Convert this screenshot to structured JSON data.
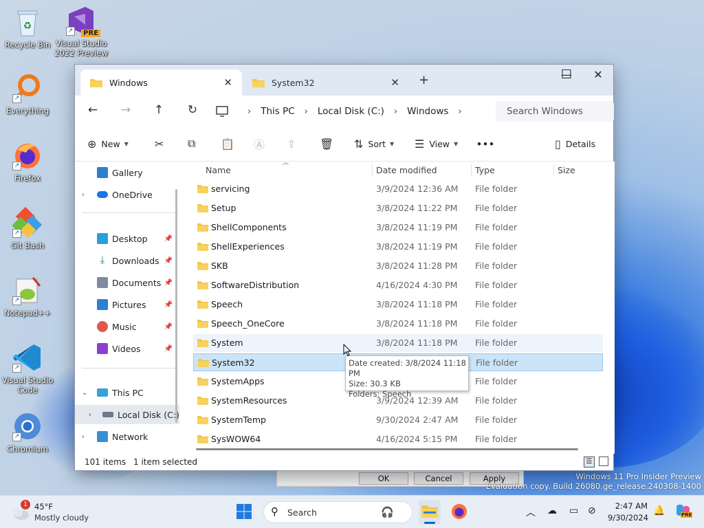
{
  "desktop": {
    "icons": [
      {
        "label": "Recycle Bin"
      },
      {
        "label": "Visual Studio 2022 Preview",
        "badge": "PRE"
      },
      {
        "label": "Everything"
      },
      {
        "label": "Firefox"
      },
      {
        "label": "Git Bash"
      },
      {
        "label": "Notepad++"
      },
      {
        "label": "Visual Studio Code"
      },
      {
        "label": "Chromium"
      }
    ]
  },
  "window": {
    "tabs": [
      {
        "label": "Windows",
        "active": true
      },
      {
        "label": "System32",
        "active": false
      }
    ],
    "controls": {
      "minimize": "—",
      "maximize": "☐",
      "close": "✕"
    },
    "breadcrumb": [
      "This PC",
      "Local Disk (C:)",
      "Windows"
    ],
    "search_placeholder": "Search Windows",
    "toolbar": {
      "new_label": "New",
      "sort_label": "Sort",
      "view_label": "View",
      "more_label": "•••",
      "details_label": "Details"
    },
    "nav": {
      "gallery": "Gallery",
      "onedrive": "OneDrive",
      "desktop": "Desktop",
      "downloads": "Downloads",
      "documents": "Documents",
      "pictures": "Pictures",
      "music": "Music",
      "videos": "Videos",
      "thispc": "This PC",
      "localdisk": "Local Disk (C:)",
      "network": "Network"
    },
    "columns": {
      "name": "Name",
      "date": "Date modified",
      "type": "Type",
      "size": "Size"
    },
    "rows": [
      {
        "name": "servicing",
        "date": "3/9/2024 12:36 AM",
        "type": "File folder"
      },
      {
        "name": "Setup",
        "date": "3/8/2024 11:22 PM",
        "type": "File folder"
      },
      {
        "name": "ShellComponents",
        "date": "3/8/2024 11:19 PM",
        "type": "File folder"
      },
      {
        "name": "ShellExperiences",
        "date": "3/8/2024 11:19 PM",
        "type": "File folder"
      },
      {
        "name": "SKB",
        "date": "3/8/2024 11:28 PM",
        "type": "File folder"
      },
      {
        "name": "SoftwareDistribution",
        "date": "4/16/2024 4:30 PM",
        "type": "File folder"
      },
      {
        "name": "Speech",
        "date": "3/8/2024 11:18 PM",
        "type": "File folder"
      },
      {
        "name": "Speech_OneCore",
        "date": "3/8/2024 11:18 PM",
        "type": "File folder"
      },
      {
        "name": "System",
        "date": "3/8/2024 11:18 PM",
        "type": "File folder"
      },
      {
        "name": "System32",
        "date": "",
        "type": "File folder"
      },
      {
        "name": "SystemApps",
        "date": "",
        "type": "File folder"
      },
      {
        "name": "SystemResources",
        "date": "3/9/2024 12:39 AM",
        "type": "File folder"
      },
      {
        "name": "SystemTemp",
        "date": "9/30/2024 2:47 AM",
        "type": "File folder"
      },
      {
        "name": "SysWOW64",
        "date": "4/16/2024 5:15 PM",
        "type": "File folder"
      }
    ],
    "tooltip": {
      "line1": "Date created: 3/8/2024 11:18 PM",
      "line2": "Size: 30.3 KB",
      "line3": "Folders: Speech"
    },
    "status": {
      "items": "101 items",
      "selected": "1 item selected"
    }
  },
  "dialog": {
    "ok": "OK",
    "cancel": "Cancel",
    "apply": "Apply"
  },
  "watermark": {
    "line1": "Windows 11 Pro Insider Preview",
    "line2": "Evaluation copy. Build 26080.ge_release.240308-1400"
  },
  "taskbar": {
    "weather_temp": "45°F",
    "weather_desc": "Mostly cloudy",
    "weather_badge": "1",
    "search_label": "Search",
    "time": "2:47 AM",
    "date": "9/30/2024",
    "copilot_badge": "PRE"
  },
  "colors": {
    "accent": "#0067c0",
    "folder": "#f4c542",
    "selection": "#cce4f7"
  }
}
